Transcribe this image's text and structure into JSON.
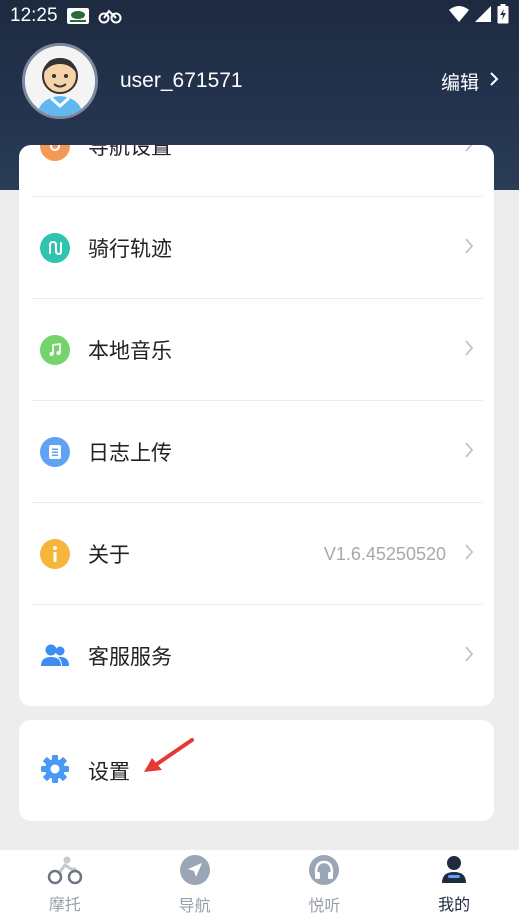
{
  "status_bar": {
    "time": "12:25"
  },
  "profile": {
    "username": "user_671571",
    "edit_label": "编辑"
  },
  "menu": {
    "items": [
      {
        "label": "导航设置",
        "icon": "navigation-settings-icon",
        "color": "#f49a57"
      },
      {
        "label": "骑行轨迹",
        "icon": "track-icon",
        "color": "#2ec4b0"
      },
      {
        "label": "本地音乐",
        "icon": "music-icon",
        "color": "#74d36a"
      },
      {
        "label": "日志上传",
        "icon": "log-icon",
        "color": "#5fa1f3"
      },
      {
        "label": "关于",
        "icon": "info-icon",
        "color": "#f6b63c",
        "value": "V1.6.45250520"
      },
      {
        "label": "客服服务",
        "icon": "customer-service-icon",
        "color": "#3d8ef0"
      }
    ]
  },
  "settings": {
    "label": "设置",
    "icon": "gear-icon",
    "color": "#4a9af5"
  },
  "bottom_nav": {
    "items": [
      {
        "label": "摩托",
        "icon": "motorcycle-icon"
      },
      {
        "label": "导航",
        "icon": "navigation-icon"
      },
      {
        "label": "悦听",
        "icon": "headphones-icon"
      },
      {
        "label": "我的",
        "icon": "user-icon",
        "active": true
      }
    ]
  },
  "colors": {
    "header_top": "#1d2a40",
    "header_bottom": "#2a3c58",
    "accent_active": "#1f2b3f",
    "annotation_red": "#e53935"
  }
}
